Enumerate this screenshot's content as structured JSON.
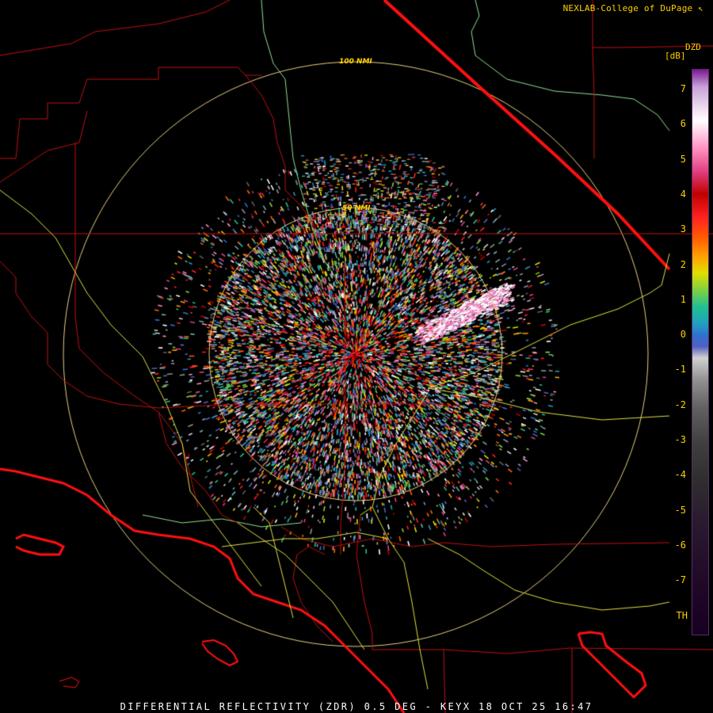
{
  "credit": "NEXLAB-College of DuPage",
  "credit_icon": "cursor-arrow-icon",
  "legend": {
    "product": "DZD",
    "unit": "[dB]",
    "ticks": [
      "7",
      "6",
      "5",
      "4",
      "3",
      "2",
      "1",
      "0",
      "-1",
      "-2",
      "-3",
      "-4",
      "-5",
      "-6",
      "-7",
      "TH"
    ]
  },
  "rings": {
    "outer_label": "100 NMI",
    "inner_label": "50 NMI"
  },
  "caption": "DIFFERENTIAL REFLECTIVITY (ZDR) 0.5 DEG - KEYX 18 OCT 25 16:47",
  "colors": {
    "text_yellow": "#ffd000",
    "ring": "#e8d080",
    "state_county_lines": "#c01010",
    "coastline": "#ff1010",
    "highways": "#e0e040",
    "rivers": "#90e090",
    "background": "#000000"
  }
}
